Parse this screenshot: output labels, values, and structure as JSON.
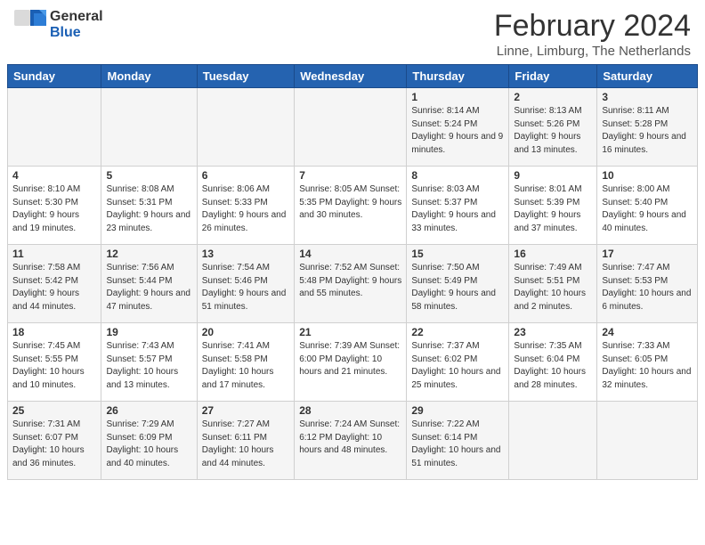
{
  "header": {
    "logo_line1": "General",
    "logo_line2": "Blue",
    "title": "February 2024",
    "subtitle": "Linne, Limburg, The Netherlands"
  },
  "days_of_week": [
    "Sunday",
    "Monday",
    "Tuesday",
    "Wednesday",
    "Thursday",
    "Friday",
    "Saturday"
  ],
  "weeks": [
    [
      {
        "day": "",
        "info": ""
      },
      {
        "day": "",
        "info": ""
      },
      {
        "day": "",
        "info": ""
      },
      {
        "day": "",
        "info": ""
      },
      {
        "day": "1",
        "info": "Sunrise: 8:14 AM\nSunset: 5:24 PM\nDaylight: 9 hours\nand 9 minutes."
      },
      {
        "day": "2",
        "info": "Sunrise: 8:13 AM\nSunset: 5:26 PM\nDaylight: 9 hours\nand 13 minutes."
      },
      {
        "day": "3",
        "info": "Sunrise: 8:11 AM\nSunset: 5:28 PM\nDaylight: 9 hours\nand 16 minutes."
      }
    ],
    [
      {
        "day": "4",
        "info": "Sunrise: 8:10 AM\nSunset: 5:30 PM\nDaylight: 9 hours\nand 19 minutes."
      },
      {
        "day": "5",
        "info": "Sunrise: 8:08 AM\nSunset: 5:31 PM\nDaylight: 9 hours\nand 23 minutes."
      },
      {
        "day": "6",
        "info": "Sunrise: 8:06 AM\nSunset: 5:33 PM\nDaylight: 9 hours\nand 26 minutes."
      },
      {
        "day": "7",
        "info": "Sunrise: 8:05 AM\nSunset: 5:35 PM\nDaylight: 9 hours\nand 30 minutes."
      },
      {
        "day": "8",
        "info": "Sunrise: 8:03 AM\nSunset: 5:37 PM\nDaylight: 9 hours\nand 33 minutes."
      },
      {
        "day": "9",
        "info": "Sunrise: 8:01 AM\nSunset: 5:39 PM\nDaylight: 9 hours\nand 37 minutes."
      },
      {
        "day": "10",
        "info": "Sunrise: 8:00 AM\nSunset: 5:40 PM\nDaylight: 9 hours\nand 40 minutes."
      }
    ],
    [
      {
        "day": "11",
        "info": "Sunrise: 7:58 AM\nSunset: 5:42 PM\nDaylight: 9 hours\nand 44 minutes."
      },
      {
        "day": "12",
        "info": "Sunrise: 7:56 AM\nSunset: 5:44 PM\nDaylight: 9 hours\nand 47 minutes."
      },
      {
        "day": "13",
        "info": "Sunrise: 7:54 AM\nSunset: 5:46 PM\nDaylight: 9 hours\nand 51 minutes."
      },
      {
        "day": "14",
        "info": "Sunrise: 7:52 AM\nSunset: 5:48 PM\nDaylight: 9 hours\nand 55 minutes."
      },
      {
        "day": "15",
        "info": "Sunrise: 7:50 AM\nSunset: 5:49 PM\nDaylight: 9 hours\nand 58 minutes."
      },
      {
        "day": "16",
        "info": "Sunrise: 7:49 AM\nSunset: 5:51 PM\nDaylight: 10 hours\nand 2 minutes."
      },
      {
        "day": "17",
        "info": "Sunrise: 7:47 AM\nSunset: 5:53 PM\nDaylight: 10 hours\nand 6 minutes."
      }
    ],
    [
      {
        "day": "18",
        "info": "Sunrise: 7:45 AM\nSunset: 5:55 PM\nDaylight: 10 hours\nand 10 minutes."
      },
      {
        "day": "19",
        "info": "Sunrise: 7:43 AM\nSunset: 5:57 PM\nDaylight: 10 hours\nand 13 minutes."
      },
      {
        "day": "20",
        "info": "Sunrise: 7:41 AM\nSunset: 5:58 PM\nDaylight: 10 hours\nand 17 minutes."
      },
      {
        "day": "21",
        "info": "Sunrise: 7:39 AM\nSunset: 6:00 PM\nDaylight: 10 hours\nand 21 minutes."
      },
      {
        "day": "22",
        "info": "Sunrise: 7:37 AM\nSunset: 6:02 PM\nDaylight: 10 hours\nand 25 minutes."
      },
      {
        "day": "23",
        "info": "Sunrise: 7:35 AM\nSunset: 6:04 PM\nDaylight: 10 hours\nand 28 minutes."
      },
      {
        "day": "24",
        "info": "Sunrise: 7:33 AM\nSunset: 6:05 PM\nDaylight: 10 hours\nand 32 minutes."
      }
    ],
    [
      {
        "day": "25",
        "info": "Sunrise: 7:31 AM\nSunset: 6:07 PM\nDaylight: 10 hours\nand 36 minutes."
      },
      {
        "day": "26",
        "info": "Sunrise: 7:29 AM\nSunset: 6:09 PM\nDaylight: 10 hours\nand 40 minutes."
      },
      {
        "day": "27",
        "info": "Sunrise: 7:27 AM\nSunset: 6:11 PM\nDaylight: 10 hours\nand 44 minutes."
      },
      {
        "day": "28",
        "info": "Sunrise: 7:24 AM\nSunset: 6:12 PM\nDaylight: 10 hours\nand 48 minutes."
      },
      {
        "day": "29",
        "info": "Sunrise: 7:22 AM\nSunset: 6:14 PM\nDaylight: 10 hours\nand 51 minutes."
      },
      {
        "day": "",
        "info": ""
      },
      {
        "day": "",
        "info": ""
      }
    ]
  ]
}
